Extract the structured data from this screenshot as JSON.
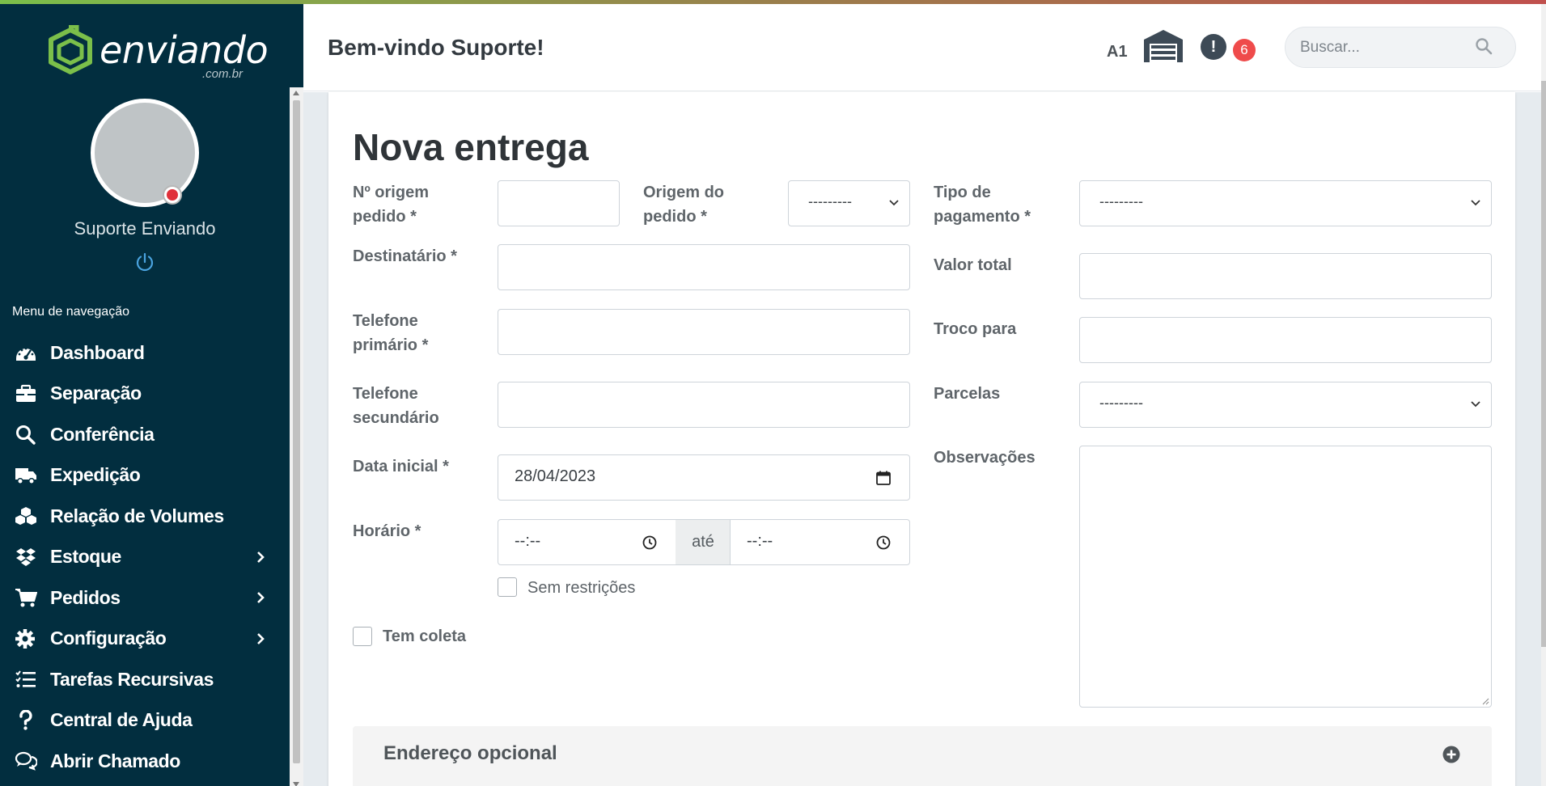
{
  "brand": {
    "name": "enviando",
    "domain": ".com.br",
    "primary_color": "#022e3f",
    "accent_color": "#7bbf4a"
  },
  "user": {
    "name": "Suporte Enviando"
  },
  "header": {
    "welcome": "Bem-vindo Suporte!",
    "warehouse_code": "A1",
    "alert_count": "6",
    "search_placeholder": "Buscar..."
  },
  "nav": {
    "title": "Menu de navegação",
    "items": [
      {
        "label": "Dashboard",
        "icon": "tachometer-icon"
      },
      {
        "label": "Separação",
        "icon": "briefcase-icon"
      },
      {
        "label": "Conferência",
        "icon": "search-icon"
      },
      {
        "label": "Expedição",
        "icon": "truck-icon"
      },
      {
        "label": "Relação de Volumes",
        "icon": "boxes-icon"
      },
      {
        "label": "Estoque",
        "icon": "dropbox-icon",
        "has_submenu": true
      },
      {
        "label": "Pedidos",
        "icon": "cart-icon",
        "has_submenu": true
      },
      {
        "label": "Configuração",
        "icon": "gear-icon",
        "has_submenu": true
      },
      {
        "label": "Tarefas Recursivas",
        "icon": "tasks-icon"
      },
      {
        "label": "Central de Ajuda",
        "icon": "question-icon"
      },
      {
        "label": "Abrir Chamado",
        "icon": "comments-icon"
      }
    ]
  },
  "form": {
    "title": "Nova entrega",
    "origem_numero": {
      "label_l1": "Nº origem",
      "label_l2": "pedido *",
      "value": ""
    },
    "origem_pedido": {
      "label_l1": "Origem do",
      "label_l2": "pedido *",
      "selected": "---------"
    },
    "tipo_pagamento": {
      "label_l1": "Tipo de",
      "label_l2": "pagamento *",
      "selected": "---------"
    },
    "destinatario": {
      "label": "Destinatário *",
      "value": ""
    },
    "valor_total": {
      "label": "Valor total",
      "value": ""
    },
    "telefone_primario": {
      "label_l1": "Telefone",
      "label_l2": "primário *",
      "value": ""
    },
    "troco_para": {
      "label": "Troco para",
      "value": ""
    },
    "telefone_secundario": {
      "label_l1": "Telefone",
      "label_l2": "secundário",
      "value": ""
    },
    "parcelas": {
      "label": "Parcelas",
      "selected": "---------"
    },
    "data_inicial": {
      "label": "Data inicial *",
      "value": "28/04/2023"
    },
    "observacoes": {
      "label": "Observações",
      "value": ""
    },
    "horario": {
      "label": "Horário *",
      "from": "--:--",
      "separator": "até",
      "to": "--:--"
    },
    "sem_restricoes": {
      "label": "Sem restrições",
      "checked": false
    },
    "tem_coleta": {
      "label": "Tem coleta",
      "checked": false
    },
    "endereco_opcional": {
      "label": "Endereço opcional"
    }
  }
}
